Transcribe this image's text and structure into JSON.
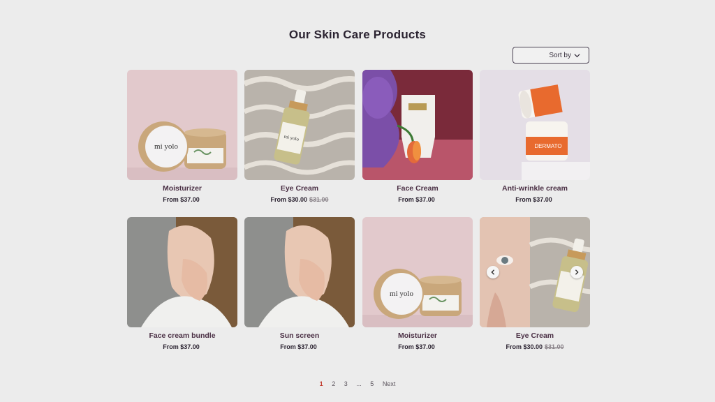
{
  "page": {
    "title": "Our Skin Care Products"
  },
  "sort": {
    "label": "Sort by",
    "icon": "chevron-down-icon"
  },
  "products": [
    {
      "name": "Moisturizer",
      "price": "From $37.00",
      "old_price": ""
    },
    {
      "name": "Eye Cream",
      "price": "From $30.00",
      "old_price": "$31.00"
    },
    {
      "name": "Face Cream",
      "price": "From $37.00",
      "old_price": ""
    },
    {
      "name": "Anti-wrinkle cream",
      "price": "From $37.00",
      "old_price": ""
    },
    {
      "name": "Face cream bundle",
      "price": "From $37.00",
      "old_price": ""
    },
    {
      "name": "Sun screen",
      "price": "From $37.00",
      "old_price": ""
    },
    {
      "name": "Moisturizer",
      "price": "From $37.00",
      "old_price": ""
    },
    {
      "name": "Eye Cream",
      "price": "From $30.00",
      "old_price": "$31.00"
    }
  ],
  "brand_text": "mi yolo",
  "pagination": {
    "pages": [
      "1",
      "2",
      "3",
      "...",
      "5"
    ],
    "next": "Next",
    "current": "1"
  },
  "colors": {
    "accent": "#c0392b",
    "title": "#2b2331",
    "product_name": "#4a2f44"
  }
}
